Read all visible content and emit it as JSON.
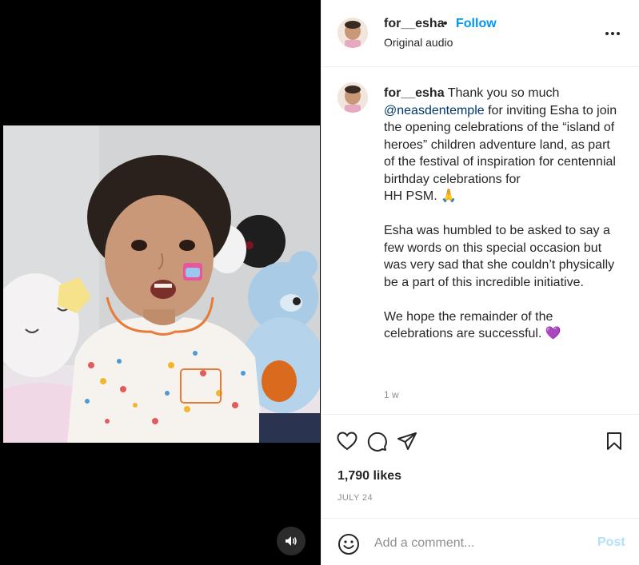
{
  "post": {
    "username": "for__esha",
    "follow_label": "Follow",
    "separator": "•",
    "audio_label": "Original audio",
    "more_icon": "more-horizontal-icon"
  },
  "caption": {
    "username": "for__esha",
    "line1": "Thank you so much",
    "mention": "@neasdentemple",
    "part1": "for inviting Esha to join the opening celebrations of the “island of heroes” children adventure land, as part of the festival of inspiration for centennial birthday celebrations for",
    "part1b": "HH PSM.",
    "emoji1": "🙏",
    "para2": "Esha was humbled to be asked to say a few words on this special occasion but was very sad that she couldn’t physically be a part of this incredible initiative.",
    "para3": "We hope the remainder of the celebrations are successful.",
    "emoji2": "💜",
    "timestamp": "1 w"
  },
  "actions": {
    "like_icon": "heart-icon",
    "comment_icon": "comment-icon",
    "share_icon": "paper-plane-icon",
    "save_icon": "bookmark-icon",
    "likes": "1,790 likes",
    "date": "JULY 24"
  },
  "comment": {
    "emoji_icon": "smiley-icon",
    "placeholder": "Add a comment...",
    "post_label": "Post"
  },
  "media": {
    "mute_icon": "speaker-icon"
  },
  "colors": {
    "link_blue": "#0095f6",
    "post_disabled": "#b2dffc",
    "muted_text": "#8e8e8e"
  }
}
